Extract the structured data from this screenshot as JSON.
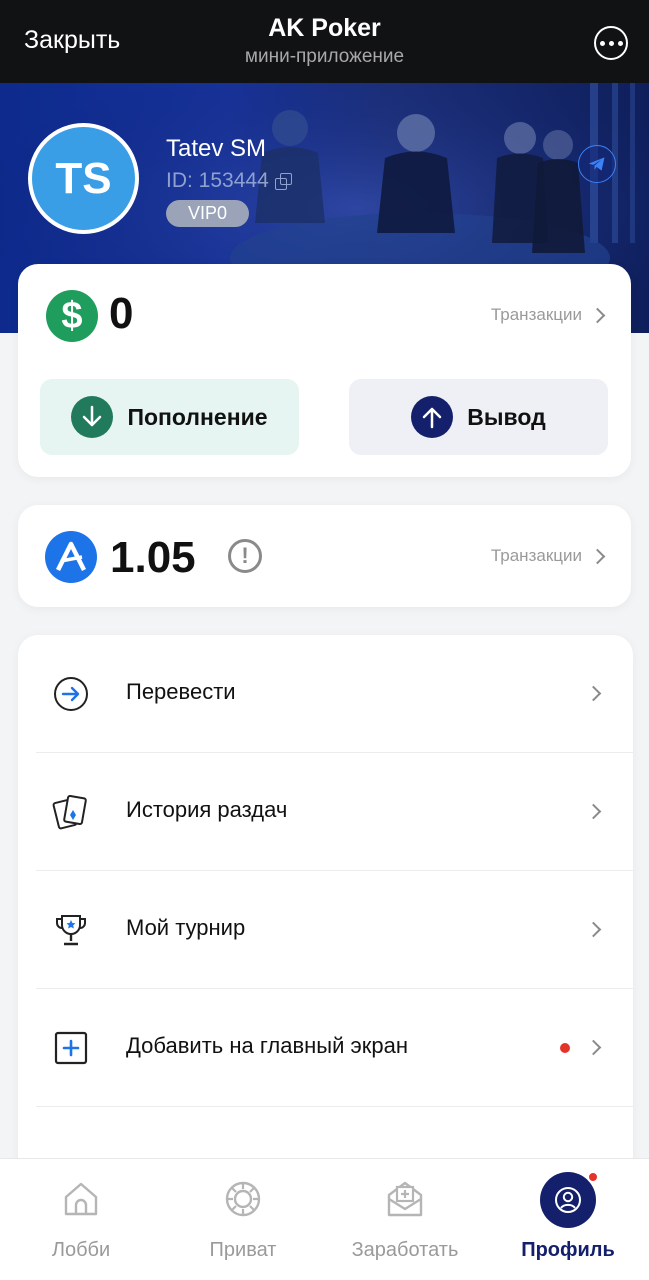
{
  "header": {
    "close_label": "Закрыть",
    "title": "AK Poker",
    "subtitle": "мини-приложение",
    "more_icon": "more-dots-icon"
  },
  "profile": {
    "initials": "TS",
    "name": "Tatev SM",
    "id_text": "ID: 153444",
    "vip_label": "VIP0",
    "avatar_color": "#3a9ee6",
    "banner_color": "#17329a"
  },
  "balance": {
    "currency_icon": "dollar-icon",
    "value": "0",
    "transactions_label": "Транзакции",
    "deposit_label": "Пополнение",
    "withdraw_label": "Вывод",
    "deposit_color": "#217a5c",
    "withdraw_color": "#14206b"
  },
  "token": {
    "icon": "ak-token-icon",
    "value": "1.05",
    "transactions_label": "Транзакции"
  },
  "menu": {
    "items": [
      {
        "label": "Перевести",
        "icon": "transfer-arrow-icon"
      },
      {
        "label": "История раздач",
        "icon": "cards-history-icon"
      },
      {
        "label": "Мой турнир",
        "icon": "trophy-icon"
      },
      {
        "label": "Добавить на главный экран",
        "icon": "add-square-icon",
        "badge": "red-dot"
      }
    ]
  },
  "bottom_nav": {
    "items": [
      {
        "label": "Лобби",
        "icon": "home-icon"
      },
      {
        "label": "Приват",
        "icon": "chip-icon"
      },
      {
        "label": "Заработать",
        "icon": "earn-mail-icon"
      },
      {
        "label": "Профиль",
        "icon": "profile-icon",
        "active": true
      }
    ],
    "active_color": "#14206b"
  }
}
